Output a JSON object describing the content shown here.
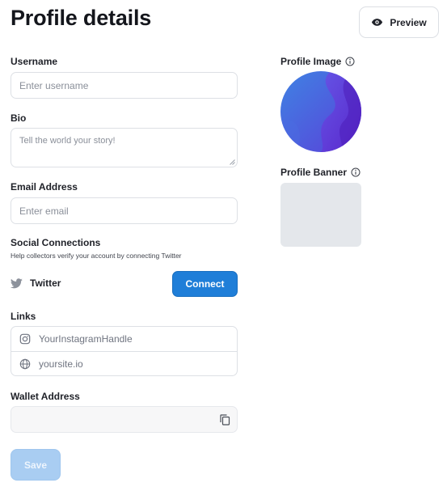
{
  "page": {
    "title": "Profile details"
  },
  "header": {
    "preview_label": "Preview"
  },
  "form": {
    "username": {
      "label": "Username",
      "placeholder": "Enter username"
    },
    "bio": {
      "label": "Bio",
      "placeholder": "Tell the world your story!"
    },
    "email": {
      "label": "Email Address",
      "placeholder": "Enter email"
    },
    "social": {
      "label": "Social Connections",
      "help": "Help collectors verify your account by connecting Twitter",
      "twitter_label": "Twitter",
      "connect_label": "Connect"
    },
    "links": {
      "label": "Links",
      "items": [
        {
          "icon": "instagram-icon",
          "placeholder": "YourInstagramHandle"
        },
        {
          "icon": "globe-icon",
          "placeholder": "yoursite.io"
        }
      ]
    },
    "wallet": {
      "label": "Wallet Address",
      "value": ""
    },
    "save_label": "Save"
  },
  "sidebar": {
    "profile_image_label": "Profile Image",
    "profile_banner_label": "Profile Banner"
  },
  "colors": {
    "primary": "#1f7ed8",
    "save_disabled": "#a9cdf2",
    "avatar_gradient_start": "#3f7de0",
    "avatar_gradient_end": "#6a2fd6",
    "banner_placeholder": "#e4e7eb"
  }
}
